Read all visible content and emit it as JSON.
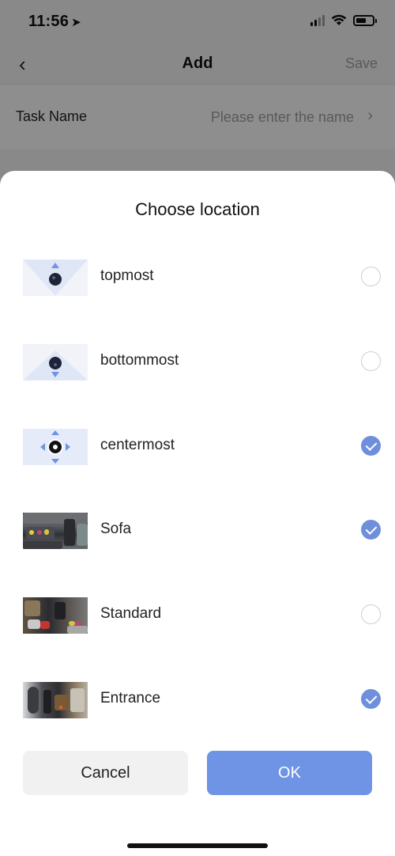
{
  "status_bar": {
    "time": "11:56",
    "location_glyph": "➤"
  },
  "nav": {
    "back_glyph": "‹",
    "title": "Add",
    "save_label": "Save"
  },
  "task": {
    "label": "Task Name",
    "placeholder": "Please enter the name",
    "chevron": "›"
  },
  "sheet": {
    "title": "Choose location",
    "items": [
      {
        "label": "topmost",
        "thumbnail": "camera-up-diagram",
        "selected": false
      },
      {
        "label": "bottommost",
        "thumbnail": "camera-down-diagram",
        "selected": false
      },
      {
        "label": "centermost",
        "thumbnail": "camera-center-diagram",
        "selected": true
      },
      {
        "label": "Sofa",
        "thumbnail": "sofa-photo",
        "selected": true
      },
      {
        "label": "Standard",
        "thumbnail": "standard-photo",
        "selected": false
      },
      {
        "label": "Entrance",
        "thumbnail": "entrance-photo",
        "selected": true
      }
    ],
    "cancel_label": "Cancel",
    "ok_label": "OK"
  },
  "colors": {
    "accent": "#6f94e6",
    "check": "#6f8fdc"
  }
}
